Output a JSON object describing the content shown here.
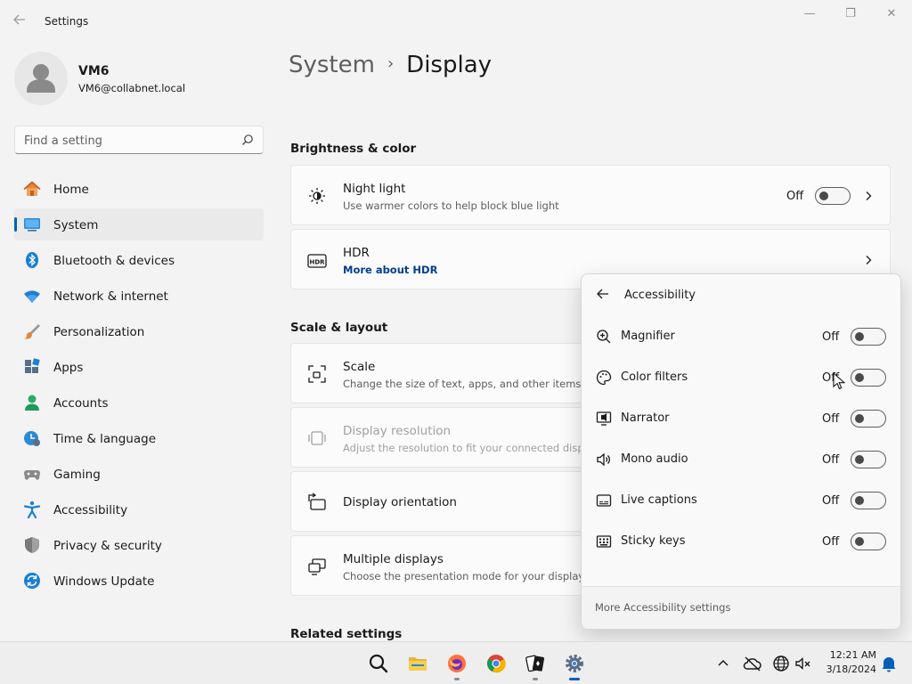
{
  "window": {
    "title": "Settings",
    "controls": {
      "minimize": "—",
      "maximize": "❐",
      "close": "✕"
    }
  },
  "user": {
    "name": "VM6",
    "email": "VM6@collabnet.local"
  },
  "search": {
    "placeholder": "Find a setting",
    "value": ""
  },
  "nav": {
    "items": [
      {
        "label": "Home",
        "icon": "home-icon"
      },
      {
        "label": "System",
        "icon": "system-icon",
        "active": true
      },
      {
        "label": "Bluetooth & devices",
        "icon": "bluetooth-icon"
      },
      {
        "label": "Network & internet",
        "icon": "network-icon"
      },
      {
        "label": "Personalization",
        "icon": "brush-icon"
      },
      {
        "label": "Apps",
        "icon": "apps-icon"
      },
      {
        "label": "Accounts",
        "icon": "accounts-icon"
      },
      {
        "label": "Time & language",
        "icon": "time-language-icon"
      },
      {
        "label": "Gaming",
        "icon": "gamepad-icon"
      },
      {
        "label": "Accessibility",
        "icon": "accessibility-icon"
      },
      {
        "label": "Privacy & security",
        "icon": "shield-icon"
      },
      {
        "label": "Windows Update",
        "icon": "update-icon"
      }
    ]
  },
  "breadcrumb": {
    "parent": "System",
    "separator": "›",
    "current": "Display"
  },
  "sections": {
    "brightness": "Brightness & color",
    "scale": "Scale & layout",
    "related": "Related settings"
  },
  "cards": {
    "night_light": {
      "title": "Night light",
      "subtitle": "Use warmer colors to help block blue light",
      "state": "Off"
    },
    "hdr": {
      "title": "HDR",
      "link": "More about HDR"
    },
    "scale": {
      "title": "Scale",
      "subtitle": "Change the size of text, apps, and other items"
    },
    "resolution": {
      "title": "Display resolution",
      "subtitle": "Adjust the resolution to fit your connected display"
    },
    "orientation": {
      "title": "Display orientation"
    },
    "multiple": {
      "title": "Multiple displays",
      "subtitle": "Choose the presentation mode for your displays"
    }
  },
  "flyout": {
    "title": "Accessibility",
    "items": [
      {
        "label": "Magnifier",
        "state": "Off",
        "icon": "magnifier-icon"
      },
      {
        "label": "Color filters",
        "state": "Off",
        "icon": "color-filters-icon"
      },
      {
        "label": "Narrator",
        "state": "Off",
        "icon": "narrator-icon"
      },
      {
        "label": "Mono audio",
        "state": "Off",
        "icon": "mono-audio-icon"
      },
      {
        "label": "Live captions",
        "state": "Off",
        "icon": "live-captions-icon"
      },
      {
        "label": "Sticky keys",
        "state": "Off",
        "icon": "sticky-keys-icon"
      }
    ],
    "footer": "More Accessibility settings"
  },
  "taskbar": {
    "apps": [
      "search-icon",
      "file-explorer-icon",
      "firefox-icon",
      "chrome-icon",
      "solitaire-icon",
      "settings-icon"
    ],
    "clock": {
      "time": "12:21 AM",
      "date": "3/18/2024"
    }
  },
  "colors": {
    "accent": "#005fb8",
    "link": "#003e92",
    "background": "#f3f3f3",
    "card": "#fbfbfb"
  }
}
